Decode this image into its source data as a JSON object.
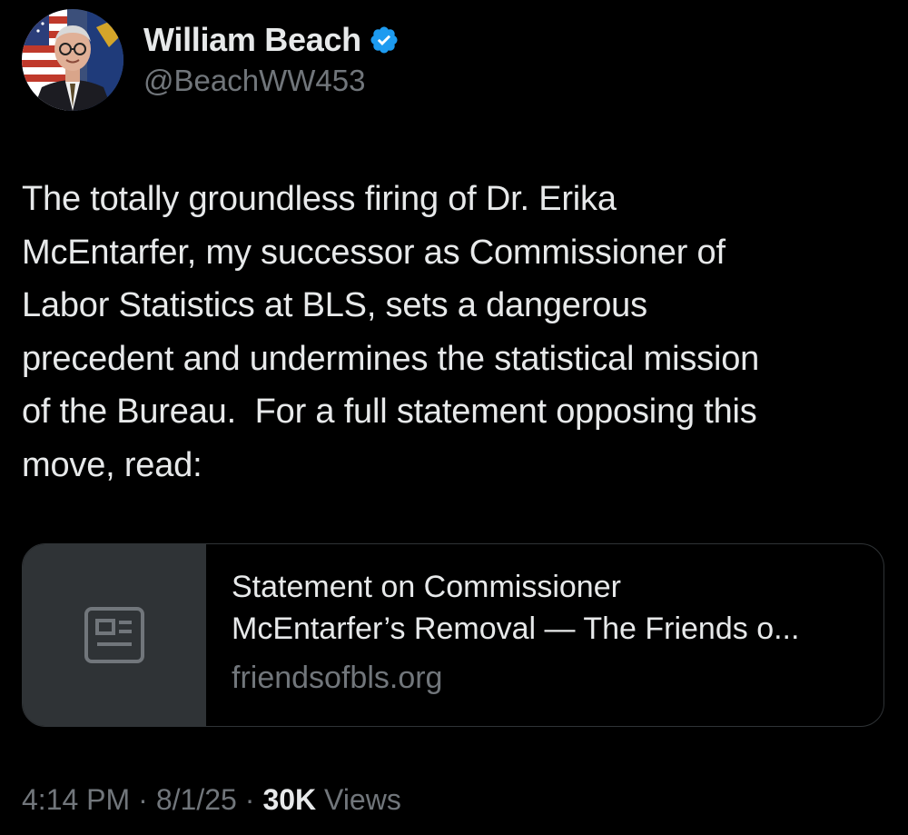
{
  "author": {
    "display_name": "William Beach",
    "handle": "@BeachWW453",
    "verified": true,
    "verified_color": "#1d9bf0"
  },
  "tweet": {
    "text": "The totally groundless firing of Dr. Erika\nMcEntarfer, my successor as Commissioner of\nLabor Statistics at BLS, sets a dangerous\nprecedent and undermines the statistical mission\nof the Bureau.  For a full statement opposing this\nmove, read:"
  },
  "link_card": {
    "icon": "article-icon",
    "title": "Statement on Commissioner\nMcEntarfer’s Removal — The Friends o...",
    "domain": "friendsofbls.org"
  },
  "meta": {
    "time": "4:14 PM",
    "separator": "·",
    "date": "8/1/25",
    "views_count": "30K",
    "views_label": "Views"
  },
  "colors": {
    "background": "#000000",
    "primary_text": "#e7e9ea",
    "secondary_text": "#71767b",
    "card_border": "#2f3336",
    "card_thumb_bg": "#2f3336"
  }
}
